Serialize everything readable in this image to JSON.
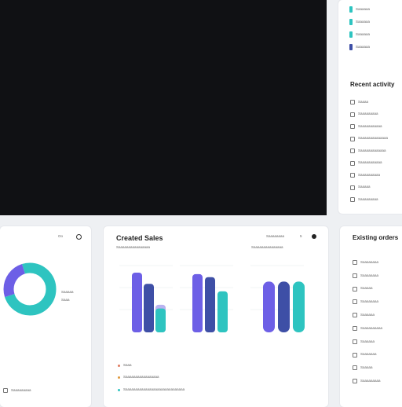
{
  "top_right": {
    "legend": [
      {
        "label": "Saaaaaa",
        "color": "#2ec4c0"
      },
      {
        "label": "Saaaaaa",
        "color": "#2ec4c0"
      },
      {
        "label": "Saaaaaa",
        "color": "#2ec4c0"
      },
      {
        "label": "Saaaaaa",
        "color": "#3e4fa6"
      }
    ],
    "heading": "Recent activity",
    "items": [
      "Saaaa",
      "Saaaaaaaaa",
      "Saaaaaaaaaaa",
      "Saaaaaaaaaaaaaa",
      "Saaaaaaaaaaaaa",
      "Saaaaaaaaaaa",
      "Saaaaaaaaaa",
      "Saaaaa",
      "Saaaaaaaaa"
    ]
  },
  "donut_card": {
    "header_text": "Oo",
    "legend": [
      "Saaaaa",
      "Saaa"
    ],
    "footer": "Saaaaaaaaa",
    "colors": {
      "primary": "#2ec4c0",
      "secondary": "#6d5fe6"
    }
  },
  "chart_card": {
    "title": "Created Sales",
    "header_text": "Saaaaaaaa",
    "header_num": "5",
    "sub_labels": [
      "Saaaaaaaaaaaaaaaa",
      "Saaaaaaaaaaaaaaa"
    ],
    "notes": [
      "Saaa",
      "Saaaaaaaaaaaaaaaaa",
      "Saaaaaaaaaaaaaaaaaaaaaaaaaaaaaa"
    ]
  },
  "bottom_right": {
    "heading": "Existing orders",
    "items": [
      "Saaaaaaaa",
      "Saaaaaaaa",
      "Saaaaa",
      "Saaaaaaaa",
      "Saaaaaa",
      "Saaaaaaaaaa",
      "Saaaaaa",
      "Saaaaaaa",
      "Saaaaa",
      "Saaaaaaaaa"
    ]
  },
  "chart_data": [
    {
      "type": "pie",
      "title": "",
      "slices": [
        {
          "label": "Saaaaa",
          "value": 75,
          "color": "#2ec4c0"
        },
        {
          "label": "Saaa",
          "value": 25,
          "color": "#6d5fe6"
        }
      ]
    },
    {
      "type": "bar",
      "title": "",
      "groups": [
        {
          "name": "group-1",
          "values": [
            80,
            65,
            37,
            32
          ],
          "colors": [
            "#6d5fe6",
            "#3e4fa6",
            "#b9b2f0",
            "#2ec4c0"
          ]
        },
        {
          "name": "group-2",
          "values": [
            78,
            74,
            55
          ],
          "colors": [
            "#6d5fe6",
            "#3e4fa6",
            "#2ec4c0"
          ]
        },
        {
          "name": "group-3",
          "values": [
            68,
            68,
            68
          ],
          "colors": [
            "#6d5fe6",
            "#3e4fa6",
            "#2ec4c0"
          ]
        }
      ]
    }
  ]
}
